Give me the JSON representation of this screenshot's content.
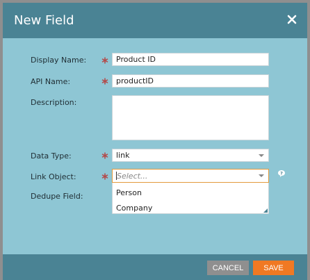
{
  "dialog": {
    "title": "New Field",
    "close_icon": "close-icon"
  },
  "fields": {
    "display_name": {
      "label": "Display Name:",
      "value": "Product ID",
      "required": true
    },
    "api_name": {
      "label": "API Name:",
      "value": "productID",
      "required": true
    },
    "description": {
      "label": "Description:",
      "value": ""
    },
    "data_type": {
      "label": "Data Type:",
      "value": "link",
      "required": true
    },
    "link_object": {
      "label": "Link Object:",
      "placeholder": "Select...",
      "required": true,
      "options": [
        "Person",
        "Company"
      ],
      "help_icon": "question-bubble-icon"
    },
    "dedupe_field": {
      "label": "Dedupe Field:"
    }
  },
  "footer": {
    "cancel_label": "CANCEL",
    "save_label": "SAVE"
  },
  "colors": {
    "header": "#4a8394",
    "body": "#8ec6d4",
    "required": "#b34a4a",
    "save": "#f07923",
    "cancel": "#8f8f8f",
    "focus_border": "#e29a3c"
  }
}
